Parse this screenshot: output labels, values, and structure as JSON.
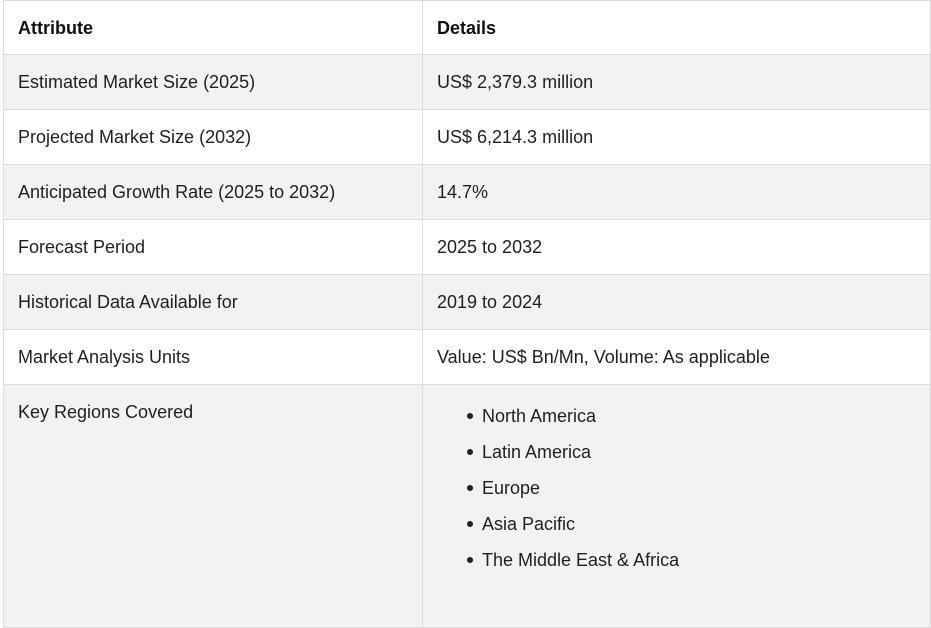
{
  "table": {
    "headers": [
      "Attribute",
      "Details"
    ],
    "rows": [
      {
        "attribute": "Estimated Market Size (2025)",
        "details": "US$ 2,379.3 million"
      },
      {
        "attribute": "Projected Market Size (2032)",
        "details": "US$ 6,214.3 million"
      },
      {
        "attribute": "Anticipated Growth Rate (2025 to 2032)",
        "details": "14.7%"
      },
      {
        "attribute": "Forecast Period",
        "details": "2025 to 2032"
      },
      {
        "attribute": "Historical Data Available for",
        "details": "2019 to 2024"
      },
      {
        "attribute": "Market Analysis Units",
        "details": "Value: US$ Bn/Mn, Volume: As applicable"
      }
    ],
    "regions_row": {
      "attribute": "Key Regions Covered",
      "items": [
        "North America",
        "Latin America",
        "Europe",
        "Asia Pacific",
        "The Middle East & Africa"
      ]
    }
  },
  "colors": {
    "row_alt_background": "#f2f2f2",
    "row_background": "#ffffff",
    "border": "#dcdcdc",
    "text": "#1f1f1f"
  }
}
